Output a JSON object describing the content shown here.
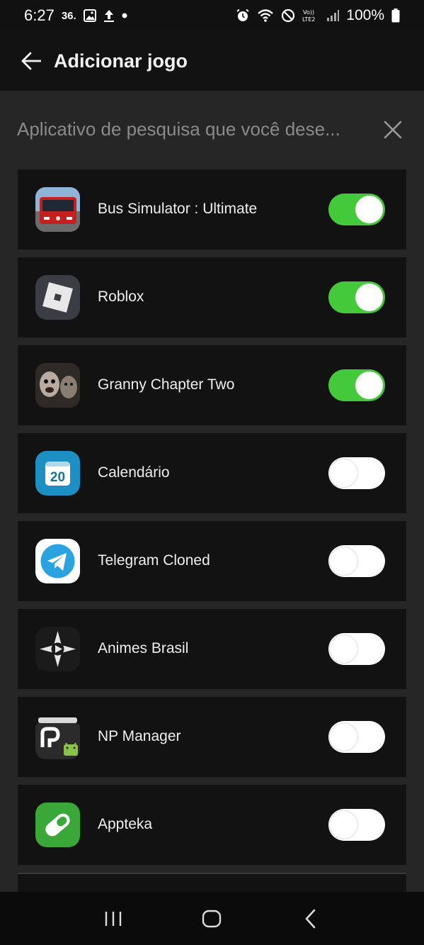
{
  "status_bar": {
    "time": "6:27",
    "notification_text": "36.",
    "battery_percent": "100%",
    "volte_label": "Vo)) LTE2"
  },
  "header": {
    "title": "Adicionar jogo"
  },
  "search": {
    "placeholder": "Aplicativo de pesquisa que você dese..."
  },
  "apps": [
    {
      "name": "Bus Simulator : Ultimate",
      "enabled": true,
      "icon": "bus-simulator-icon"
    },
    {
      "name": "Roblox",
      "enabled": true,
      "icon": "roblox-icon"
    },
    {
      "name": "Granny Chapter Two",
      "enabled": true,
      "icon": "granny-icon"
    },
    {
      "name": "Calendário",
      "enabled": false,
      "icon": "calendar-icon",
      "icon_text": "20"
    },
    {
      "name": "Telegram Cloned",
      "enabled": false,
      "icon": "telegram-icon"
    },
    {
      "name": "Animes Brasil",
      "enabled": false,
      "icon": "animes-brasil-icon"
    },
    {
      "name": "NP Manager",
      "enabled": false,
      "icon": "np-manager-icon"
    },
    {
      "name": "Appteka",
      "enabled": false,
      "icon": "appteka-icon"
    }
  ],
  "colors": {
    "toggle_on": "#43c93a",
    "toggle_off": "#ffffff",
    "background": "#262626",
    "card": "#121212"
  }
}
